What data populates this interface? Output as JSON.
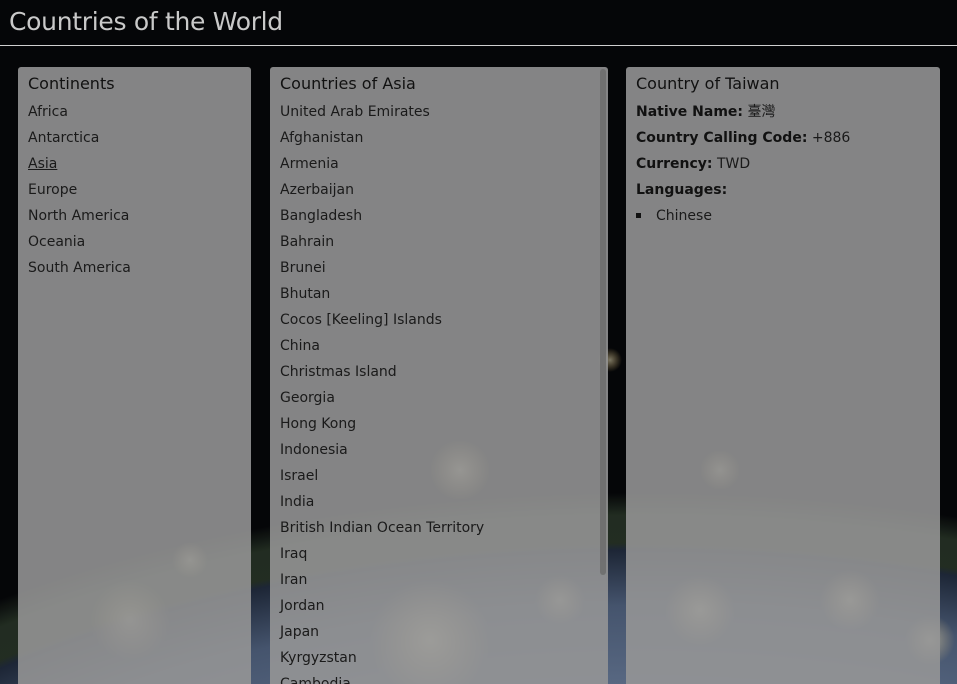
{
  "site": {
    "title": "Countries of the World"
  },
  "continents": {
    "heading": "Continents",
    "items": [
      "Africa",
      "Antarctica",
      "Asia",
      "Europe",
      "North America",
      "Oceania",
      "South America"
    ],
    "selected": "Asia"
  },
  "countries": {
    "heading": "Countries of Asia",
    "items": [
      "United Arab Emirates",
      "Afghanistan",
      "Armenia",
      "Azerbaijan",
      "Bangladesh",
      "Bahrain",
      "Brunei",
      "Bhutan",
      "Cocos [Keeling] Islands",
      "China",
      "Christmas Island",
      "Georgia",
      "Hong Kong",
      "Indonesia",
      "Israel",
      "India",
      "British Indian Ocean Territory",
      "Iraq",
      "Iran",
      "Jordan",
      "Japan",
      "Kyrgyzstan",
      "Cambodia"
    ]
  },
  "country": {
    "heading": "Country of Taiwan",
    "native_name_label": "Native Name:",
    "native_name": "臺灣",
    "calling_code_label": "Country Calling Code:",
    "calling_code": "+886",
    "currency_label": "Currency:",
    "currency": "TWD",
    "languages_label": "Languages:",
    "languages": [
      "Chinese"
    ]
  }
}
